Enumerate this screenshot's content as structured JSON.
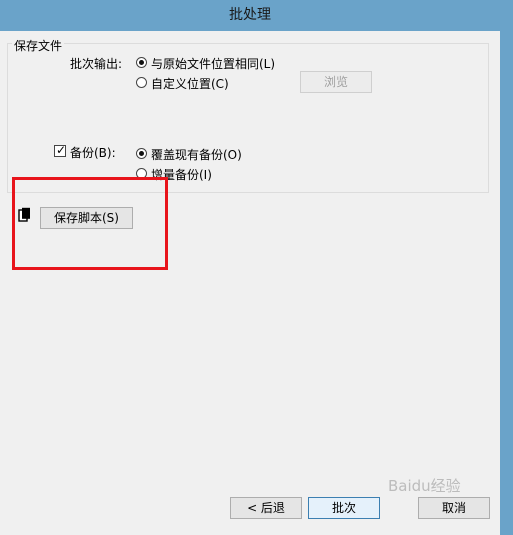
{
  "window": {
    "title": "批处理"
  },
  "group": {
    "legend": "保存文件"
  },
  "output": {
    "label": "批次输出:",
    "options": [
      "与原始文件位置相同(L)",
      "自定义位置(C)"
    ],
    "browse_label": "浏览"
  },
  "backup": {
    "checkbox_label": "备份(B):",
    "options": [
      "覆盖现有备份(O)",
      "增量备份(I)"
    ]
  },
  "save_script": {
    "label": "保存脚本(S)"
  },
  "footer": {
    "back": "< 后退",
    "batch": "批次",
    "cancel": "取消"
  },
  "watermark": "Baidu经验",
  "colors": {
    "title_bar": "#6aa3c9",
    "annotation": "#e8141b",
    "dialog_bg": "#f0f0f0"
  }
}
